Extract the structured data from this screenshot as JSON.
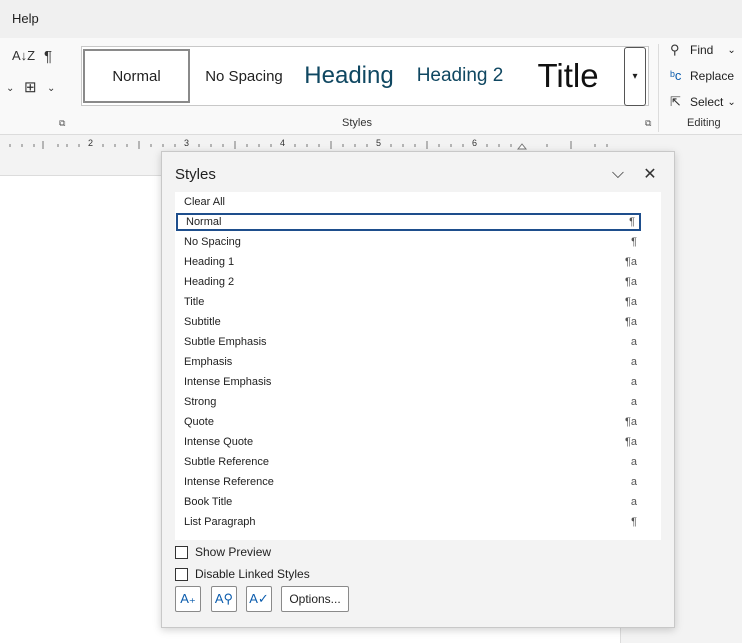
{
  "menu": {
    "help": "Help"
  },
  "ribbon": {
    "gallery": [
      {
        "label": "Normal"
      },
      {
        "label": "No Spacing"
      },
      {
        "label": "Heading"
      },
      {
        "label": "Heading 2"
      },
      {
        "label": "Title"
      }
    ],
    "styles_group_label": "Styles",
    "editing": {
      "find": "Find",
      "replace": "Replace",
      "select": "Select",
      "group_label": "Editing"
    }
  },
  "ruler": {
    "numbers": [
      "2",
      "3",
      "4",
      "5",
      "6"
    ]
  },
  "pane": {
    "title": "Styles",
    "items": [
      {
        "label": "Clear All",
        "mark": ""
      },
      {
        "label": "Normal",
        "mark": "¶"
      },
      {
        "label": "No Spacing",
        "mark": "¶"
      },
      {
        "label": "Heading 1",
        "mark": "¶a"
      },
      {
        "label": "Heading 2",
        "mark": "¶a"
      },
      {
        "label": "Title",
        "mark": "¶a"
      },
      {
        "label": "Subtitle",
        "mark": "¶a"
      },
      {
        "label": "Subtle Emphasis",
        "mark": "a"
      },
      {
        "label": "Emphasis",
        "mark": "a"
      },
      {
        "label": "Intense Emphasis",
        "mark": "a"
      },
      {
        "label": "Strong",
        "mark": "a"
      },
      {
        "label": "Quote",
        "mark": "¶a"
      },
      {
        "label": "Intense Quote",
        "mark": "¶a"
      },
      {
        "label": "Subtle Reference",
        "mark": "a"
      },
      {
        "label": "Intense Reference",
        "mark": "a"
      },
      {
        "label": "Book Title",
        "mark": "a"
      },
      {
        "label": "List Paragraph",
        "mark": "¶"
      }
    ],
    "selected_index": 1,
    "show_preview": "Show Preview",
    "disable_linked": "Disable Linked Styles",
    "options_button": "Options..."
  },
  "colors": {
    "accent": "#1e4e8c",
    "heading": "#0f4761"
  }
}
